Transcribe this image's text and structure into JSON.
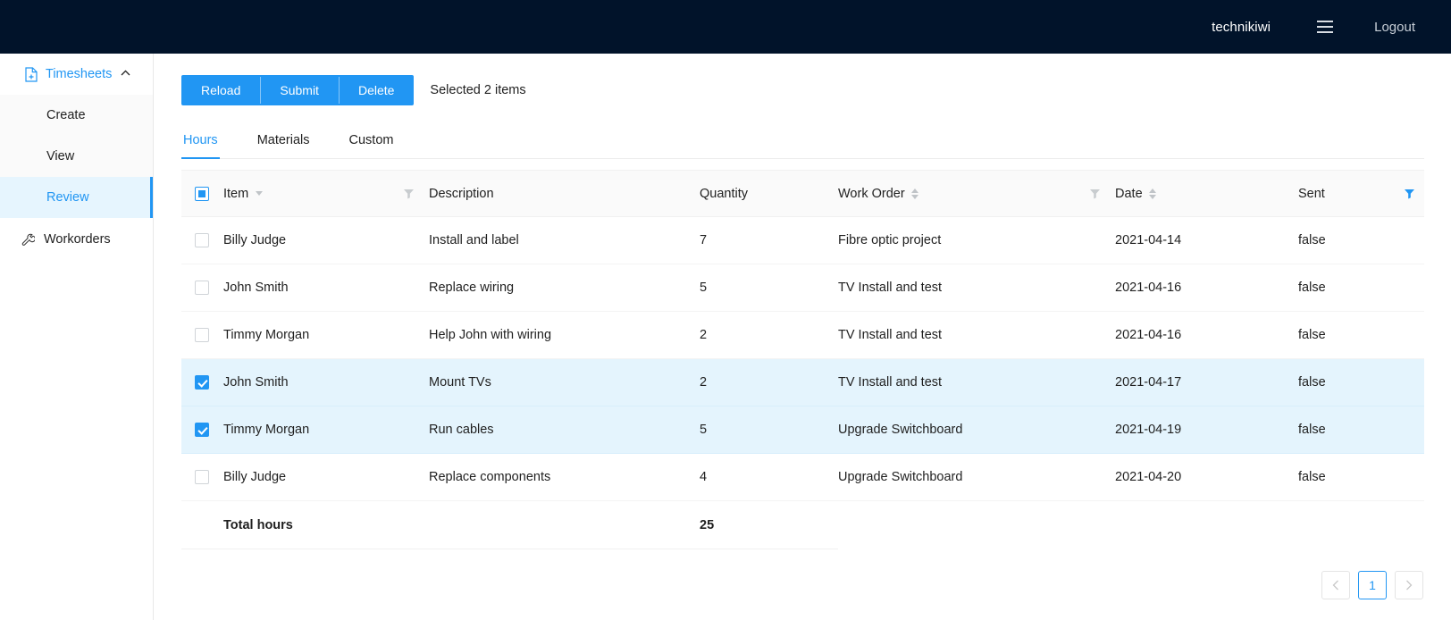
{
  "header": {
    "brand": "technikiwi",
    "menu_icon": "hamburger-icon",
    "logout_label": "Logout"
  },
  "sidebar": {
    "group": {
      "label": "Timesheets",
      "icon": "document-add-icon",
      "chevron": "chevron-up-icon",
      "expanded": true,
      "items": [
        {
          "label": "Create",
          "active": false
        },
        {
          "label": "View",
          "active": false
        },
        {
          "label": "Review",
          "active": true
        }
      ]
    },
    "bottom_items": [
      {
        "label": "Workorders",
        "icon": "wrench-icon",
        "active": false
      }
    ],
    "accent_color": "#2196f3",
    "active_bg": "#e6f5fe"
  },
  "toolbar": {
    "buttons": [
      {
        "label": "Reload",
        "name": "reload-button"
      },
      {
        "label": "Submit",
        "name": "submit-button"
      },
      {
        "label": "Delete",
        "name": "delete-button"
      }
    ],
    "status_text": "Selected 2 items",
    "button_color": "#2196f3"
  },
  "tabs": [
    {
      "label": "Hours",
      "active": true
    },
    {
      "label": "Materials",
      "active": false
    },
    {
      "label": "Custom",
      "active": false
    }
  ],
  "table": {
    "select_all_state": "indeterminate",
    "columns": [
      {
        "key": "item",
        "label": "Item",
        "sort": "single",
        "filter": "inactive"
      },
      {
        "key": "description",
        "label": "Description",
        "sort": "none",
        "filter": "none"
      },
      {
        "key": "quantity",
        "label": "Quantity",
        "sort": "none",
        "filter": "none"
      },
      {
        "key": "work_order",
        "label": "Work Order",
        "sort": "dual",
        "filter": "inactive"
      },
      {
        "key": "date",
        "label": "Date",
        "sort": "dual",
        "filter": "none"
      },
      {
        "key": "sent",
        "label": "Sent",
        "sort": "none",
        "filter": "active"
      }
    ],
    "rows": [
      {
        "selected": false,
        "item": "Billy Judge",
        "description": "Install and label",
        "quantity": "7",
        "work_order": "Fibre optic project",
        "date": "2021-04-14",
        "sent": "false"
      },
      {
        "selected": false,
        "item": "John Smith",
        "description": "Replace wiring",
        "quantity": "5",
        "work_order": "TV Install and test",
        "date": "2021-04-16",
        "sent": "false"
      },
      {
        "selected": false,
        "item": "Timmy Morgan",
        "description": "Help John with wiring",
        "quantity": "2",
        "work_order": "TV Install and test",
        "date": "2021-04-16",
        "sent": "false"
      },
      {
        "selected": true,
        "item": "John Smith",
        "description": "Mount TVs",
        "quantity": "2",
        "work_order": "TV Install and test",
        "date": "2021-04-17",
        "sent": "false"
      },
      {
        "selected": true,
        "item": "Timmy Morgan",
        "description": "Run cables",
        "quantity": "5",
        "work_order": "Upgrade Switchboard",
        "date": "2021-04-19",
        "sent": "false"
      },
      {
        "selected": false,
        "item": "Billy Judge",
        "description": "Replace components",
        "quantity": "4",
        "work_order": "Upgrade Switchboard",
        "date": "2021-04-20",
        "sent": "false"
      }
    ],
    "summary": {
      "label": "Total hours",
      "value": "25"
    }
  },
  "pagination": {
    "prev_icon": "chevron-left-icon",
    "next_icon": "chevron-right-icon",
    "pages": [
      "1"
    ],
    "current": "1"
  }
}
